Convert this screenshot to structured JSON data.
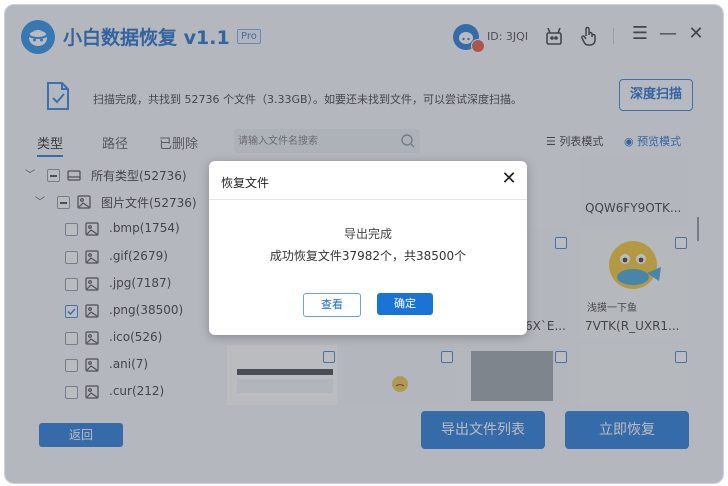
{
  "app": {
    "title": "小白数据恢复  v1.1",
    "badge": "Pro",
    "user_id": "ID: 3JQI",
    "accent_color": "#1a74d8"
  },
  "titlebar_icons": [
    "avatar-icon",
    "gift-icon",
    "hand-icon",
    "menu-icon",
    "minimize-icon",
    "close-icon"
  ],
  "window_controls": {
    "menu": "☰",
    "minimize": "—",
    "close": "✕"
  },
  "info": {
    "message": "扫描完成，共找到 52736 个文件（3.33GB）。如要还未找到文件，可以尝试深度扫描。",
    "deep_scan_label": "深度扫描"
  },
  "tabs": [
    {
      "label": "类型",
      "active": true
    },
    {
      "label": "路径",
      "active": false
    },
    {
      "label": "已删除",
      "active": false
    }
  ],
  "search": {
    "placeholder": "请输入文件名搜索"
  },
  "view_modes": {
    "list": "列表模式",
    "preview": "预览模式"
  },
  "tree": [
    {
      "label": "所有类型(52736)",
      "level": 0,
      "state": "partial",
      "icon": "drive-icon"
    },
    {
      "label": "图片文件(52736)",
      "level": 1,
      "state": "partial",
      "icon": "image-icon"
    },
    {
      "label": ".bmp(1754)",
      "level": 2,
      "state": "unchecked",
      "icon": "image-icon"
    },
    {
      "label": ".gif(2679)",
      "level": 2,
      "state": "unchecked",
      "icon": "image-icon"
    },
    {
      "label": ".jpg(7187)",
      "level": 2,
      "state": "unchecked",
      "icon": "image-icon"
    },
    {
      "label": ".png(38500)",
      "level": 2,
      "state": "checked",
      "icon": "image-icon"
    },
    {
      "label": ".ico(526)",
      "level": 2,
      "state": "unchecked",
      "icon": "image-icon"
    },
    {
      "label": ".ani(7)",
      "level": 2,
      "state": "unchecked",
      "icon": "image-icon"
    },
    {
      "label": ".cur(212)",
      "level": 2,
      "state": "unchecked",
      "icon": "image-icon"
    }
  ],
  "tiles": {
    "name_top_right": "QQW6FY9OTK...",
    "name_mid_right": "7VTK(R_UXR1...",
    "name_mid_left_partial": "6X`E...",
    "emoji_caption": "浅摸一下鱼"
  },
  "buttons": {
    "back": "返回",
    "export": "导出文件列表",
    "recover": "立即恢复"
  },
  "dialog": {
    "title": "恢复文件",
    "close": "✕",
    "line1": "导出完成",
    "line2": "成功恢复文件37982个，共38500个",
    "view": "查看",
    "ok": "确定"
  }
}
